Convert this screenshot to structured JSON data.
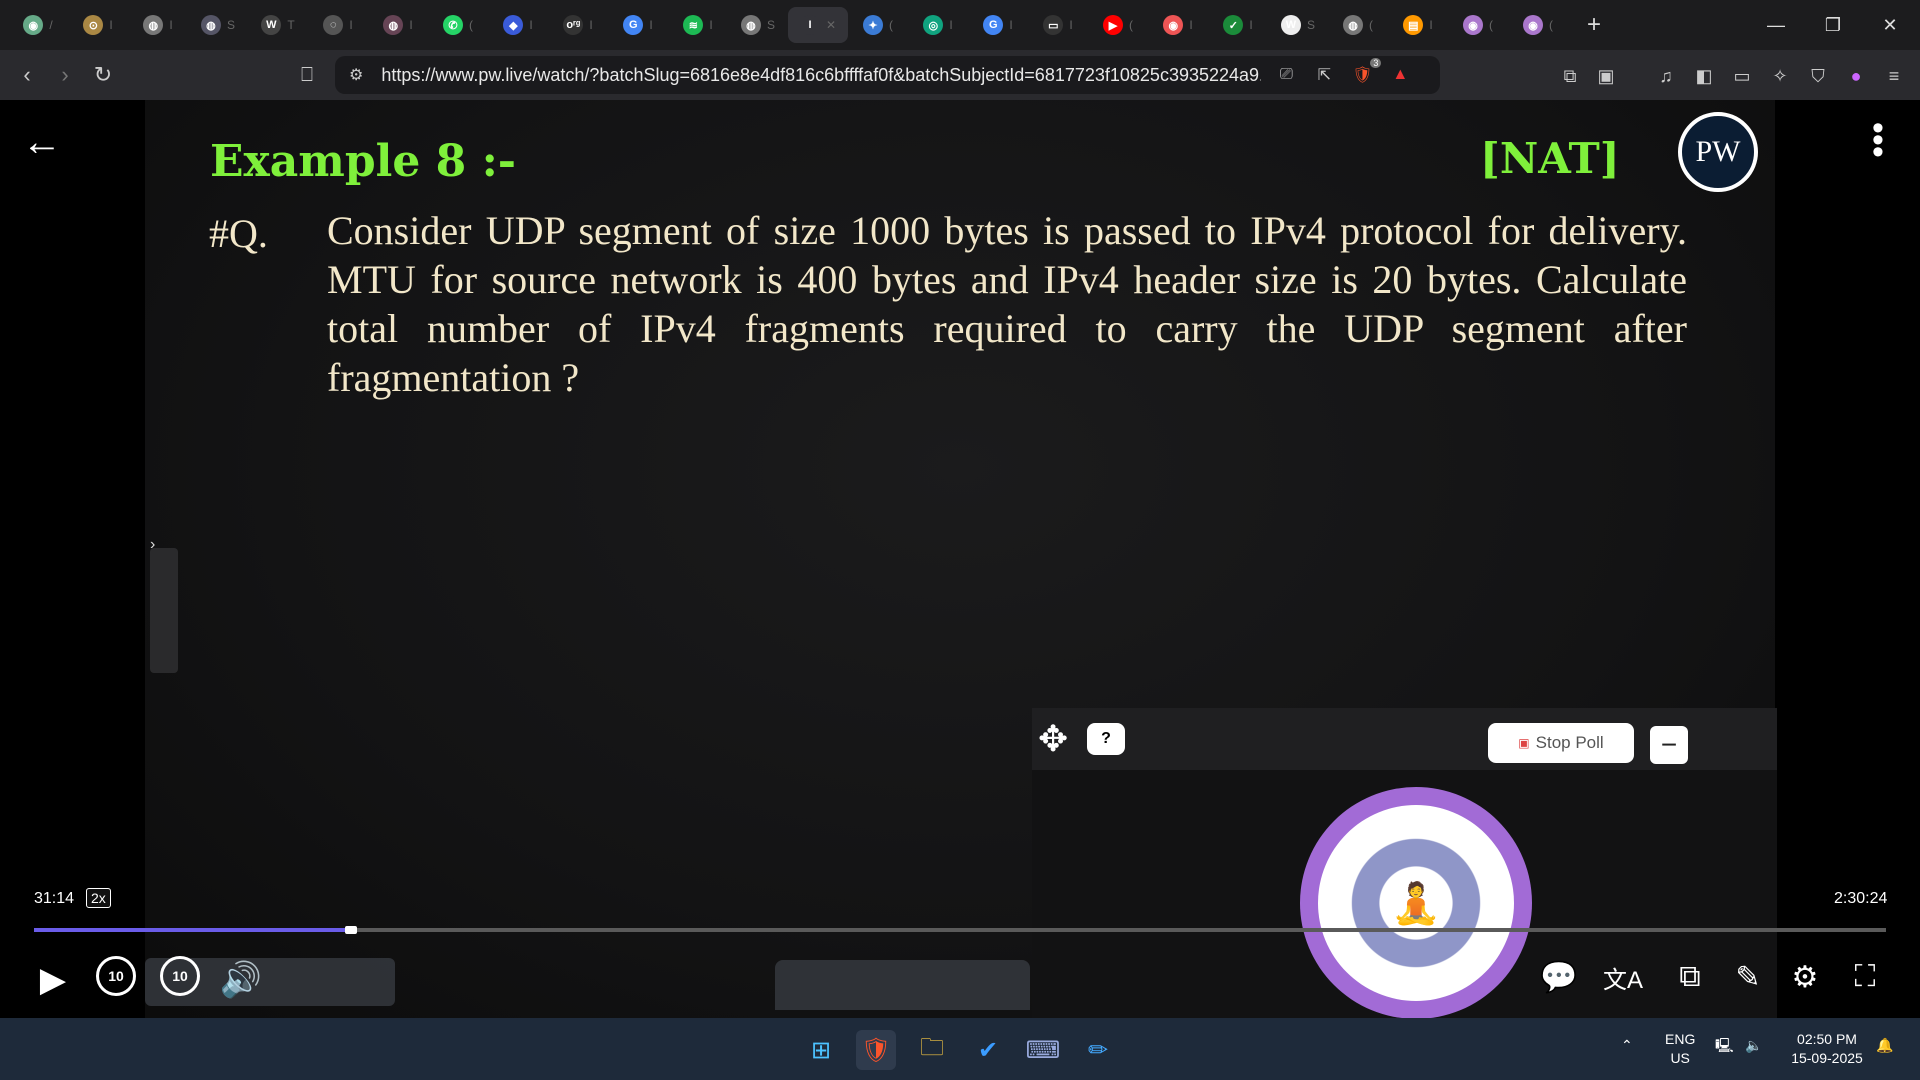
{
  "browser": {
    "tabs": [
      {
        "fav": "◉",
        "color": "#6a8",
        "label": "/"
      },
      {
        "fav": "⊙",
        "color": "#a84",
        "label": "I"
      },
      {
        "fav": "◍",
        "color": "#777",
        "label": "I"
      },
      {
        "fav": "◍",
        "color": "#556",
        "label": "S"
      },
      {
        "fav": "W",
        "color": "#444",
        "label": "T"
      },
      {
        "fav": "◌",
        "color": "#555",
        "label": "I"
      },
      {
        "fav": "◍",
        "color": "#645",
        "label": "I"
      },
      {
        "fav": "✆",
        "color": "#25d366",
        "label": "("
      },
      {
        "fav": "◆",
        "color": "#3a5bd9",
        "label": "I"
      },
      {
        "fav": "oʳᵍ",
        "color": "#333",
        "label": "I"
      },
      {
        "fav": "G",
        "color": "#4285f4",
        "label": "I"
      },
      {
        "fav": "≋",
        "color": "#1db954",
        "label": "I"
      },
      {
        "fav": "◍",
        "color": "#777",
        "label": "S"
      },
      {
        "fav": "I",
        "color": "#333338",
        "label": "✕"
      },
      {
        "fav": "✦",
        "color": "#3b7bd5",
        "label": "("
      },
      {
        "fav": "◎",
        "color": "#10a37f",
        "label": "I"
      },
      {
        "fav": "G",
        "color": "#4285f4",
        "label": "I"
      },
      {
        "fav": "▭",
        "color": "#333",
        "label": "I"
      },
      {
        "fav": "▶",
        "color": "#ff0000",
        "label": "("
      },
      {
        "fav": "◉",
        "color": "#e55",
        "label": "I"
      },
      {
        "fav": "✓",
        "color": "#1b8b3a",
        "label": "I"
      },
      {
        "fav": "W",
        "color": "#eee",
        "label": "S"
      },
      {
        "fav": "◍",
        "color": "#777",
        "label": "("
      },
      {
        "fav": "▤",
        "color": "#f90",
        "label": "I"
      },
      {
        "fav": "◉",
        "color": "#a7c",
        "label": "("
      },
      {
        "fav": "◉",
        "color": "#a7c",
        "label": "("
      }
    ],
    "new_tab": "+",
    "url": "https://www.pw.live/watch/?batchSlug=6816e8e4df816c6bffffaf0f&batchSubjectId=6817723f10825c3935224a9...",
    "shields_badge": "3"
  },
  "slide": {
    "title": "Example 8 :-",
    "tag": "[NAT]",
    "q_label": "#Q.",
    "question": "Consider UDP segment of size 1000 bytes is passed to IPv4 protocol for delivery. MTU for source network is 400 bytes and IPv4 header size is 20 bytes. Calculate total number of IPv4 fragments required to carry the UDP segment after fragmentation ?",
    "logo_text": "PW"
  },
  "poll": {
    "help": "?",
    "stop_label": "Stop Poll",
    "minimize": "−"
  },
  "player": {
    "current_time": "31:14",
    "speed": "2x",
    "total_time": "2:30:24",
    "progress_fraction": 0.17,
    "skip_back": "10",
    "skip_forward": "10"
  },
  "taskbar": {
    "lang_top": "ENG",
    "lang_bottom": "US",
    "time": "02:50 PM",
    "date": "15-09-2025"
  }
}
